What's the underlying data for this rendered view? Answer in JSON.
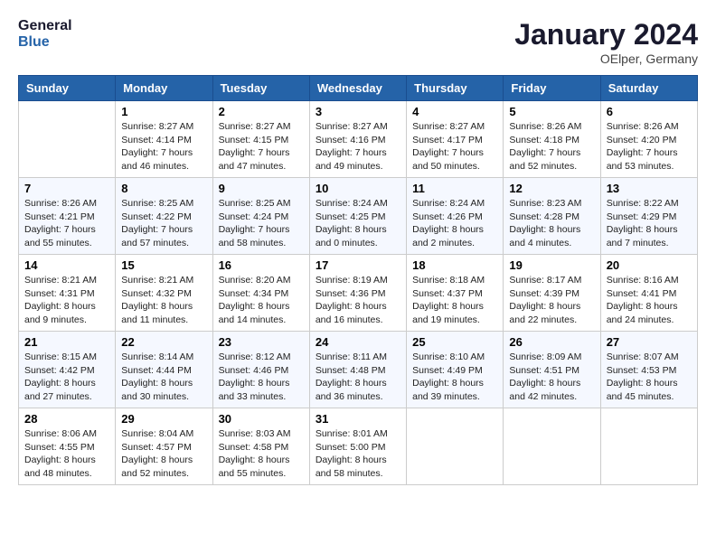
{
  "header": {
    "logo_line1": "General",
    "logo_line2": "Blue",
    "month_title": "January 2024",
    "location": "OElper, Germany"
  },
  "days_of_week": [
    "Sunday",
    "Monday",
    "Tuesday",
    "Wednesday",
    "Thursday",
    "Friday",
    "Saturday"
  ],
  "weeks": [
    [
      {
        "day": "",
        "sunrise": "",
        "sunset": "",
        "daylight": ""
      },
      {
        "day": "1",
        "sunrise": "Sunrise: 8:27 AM",
        "sunset": "Sunset: 4:14 PM",
        "daylight": "Daylight: 7 hours and 46 minutes."
      },
      {
        "day": "2",
        "sunrise": "Sunrise: 8:27 AM",
        "sunset": "Sunset: 4:15 PM",
        "daylight": "Daylight: 7 hours and 47 minutes."
      },
      {
        "day": "3",
        "sunrise": "Sunrise: 8:27 AM",
        "sunset": "Sunset: 4:16 PM",
        "daylight": "Daylight: 7 hours and 49 minutes."
      },
      {
        "day": "4",
        "sunrise": "Sunrise: 8:27 AM",
        "sunset": "Sunset: 4:17 PM",
        "daylight": "Daylight: 7 hours and 50 minutes."
      },
      {
        "day": "5",
        "sunrise": "Sunrise: 8:26 AM",
        "sunset": "Sunset: 4:18 PM",
        "daylight": "Daylight: 7 hours and 52 minutes."
      },
      {
        "day": "6",
        "sunrise": "Sunrise: 8:26 AM",
        "sunset": "Sunset: 4:20 PM",
        "daylight": "Daylight: 7 hours and 53 minutes."
      }
    ],
    [
      {
        "day": "7",
        "sunrise": "Sunrise: 8:26 AM",
        "sunset": "Sunset: 4:21 PM",
        "daylight": "Daylight: 7 hours and 55 minutes."
      },
      {
        "day": "8",
        "sunrise": "Sunrise: 8:25 AM",
        "sunset": "Sunset: 4:22 PM",
        "daylight": "Daylight: 7 hours and 57 minutes."
      },
      {
        "day": "9",
        "sunrise": "Sunrise: 8:25 AM",
        "sunset": "Sunset: 4:24 PM",
        "daylight": "Daylight: 7 hours and 58 minutes."
      },
      {
        "day": "10",
        "sunrise": "Sunrise: 8:24 AM",
        "sunset": "Sunset: 4:25 PM",
        "daylight": "Daylight: 8 hours and 0 minutes."
      },
      {
        "day": "11",
        "sunrise": "Sunrise: 8:24 AM",
        "sunset": "Sunset: 4:26 PM",
        "daylight": "Daylight: 8 hours and 2 minutes."
      },
      {
        "day": "12",
        "sunrise": "Sunrise: 8:23 AM",
        "sunset": "Sunset: 4:28 PM",
        "daylight": "Daylight: 8 hours and 4 minutes."
      },
      {
        "day": "13",
        "sunrise": "Sunrise: 8:22 AM",
        "sunset": "Sunset: 4:29 PM",
        "daylight": "Daylight: 8 hours and 7 minutes."
      }
    ],
    [
      {
        "day": "14",
        "sunrise": "Sunrise: 8:21 AM",
        "sunset": "Sunset: 4:31 PM",
        "daylight": "Daylight: 8 hours and 9 minutes."
      },
      {
        "day": "15",
        "sunrise": "Sunrise: 8:21 AM",
        "sunset": "Sunset: 4:32 PM",
        "daylight": "Daylight: 8 hours and 11 minutes."
      },
      {
        "day": "16",
        "sunrise": "Sunrise: 8:20 AM",
        "sunset": "Sunset: 4:34 PM",
        "daylight": "Daylight: 8 hours and 14 minutes."
      },
      {
        "day": "17",
        "sunrise": "Sunrise: 8:19 AM",
        "sunset": "Sunset: 4:36 PM",
        "daylight": "Daylight: 8 hours and 16 minutes."
      },
      {
        "day": "18",
        "sunrise": "Sunrise: 8:18 AM",
        "sunset": "Sunset: 4:37 PM",
        "daylight": "Daylight: 8 hours and 19 minutes."
      },
      {
        "day": "19",
        "sunrise": "Sunrise: 8:17 AM",
        "sunset": "Sunset: 4:39 PM",
        "daylight": "Daylight: 8 hours and 22 minutes."
      },
      {
        "day": "20",
        "sunrise": "Sunrise: 8:16 AM",
        "sunset": "Sunset: 4:41 PM",
        "daylight": "Daylight: 8 hours and 24 minutes."
      }
    ],
    [
      {
        "day": "21",
        "sunrise": "Sunrise: 8:15 AM",
        "sunset": "Sunset: 4:42 PM",
        "daylight": "Daylight: 8 hours and 27 minutes."
      },
      {
        "day": "22",
        "sunrise": "Sunrise: 8:14 AM",
        "sunset": "Sunset: 4:44 PM",
        "daylight": "Daylight: 8 hours and 30 minutes."
      },
      {
        "day": "23",
        "sunrise": "Sunrise: 8:12 AM",
        "sunset": "Sunset: 4:46 PM",
        "daylight": "Daylight: 8 hours and 33 minutes."
      },
      {
        "day": "24",
        "sunrise": "Sunrise: 8:11 AM",
        "sunset": "Sunset: 4:48 PM",
        "daylight": "Daylight: 8 hours and 36 minutes."
      },
      {
        "day": "25",
        "sunrise": "Sunrise: 8:10 AM",
        "sunset": "Sunset: 4:49 PM",
        "daylight": "Daylight: 8 hours and 39 minutes."
      },
      {
        "day": "26",
        "sunrise": "Sunrise: 8:09 AM",
        "sunset": "Sunset: 4:51 PM",
        "daylight": "Daylight: 8 hours and 42 minutes."
      },
      {
        "day": "27",
        "sunrise": "Sunrise: 8:07 AM",
        "sunset": "Sunset: 4:53 PM",
        "daylight": "Daylight: 8 hours and 45 minutes."
      }
    ],
    [
      {
        "day": "28",
        "sunrise": "Sunrise: 8:06 AM",
        "sunset": "Sunset: 4:55 PM",
        "daylight": "Daylight: 8 hours and 48 minutes."
      },
      {
        "day": "29",
        "sunrise": "Sunrise: 8:04 AM",
        "sunset": "Sunset: 4:57 PM",
        "daylight": "Daylight: 8 hours and 52 minutes."
      },
      {
        "day": "30",
        "sunrise": "Sunrise: 8:03 AM",
        "sunset": "Sunset: 4:58 PM",
        "daylight": "Daylight: 8 hours and 55 minutes."
      },
      {
        "day": "31",
        "sunrise": "Sunrise: 8:01 AM",
        "sunset": "Sunset: 5:00 PM",
        "daylight": "Daylight: 8 hours and 58 minutes."
      },
      {
        "day": "",
        "sunrise": "",
        "sunset": "",
        "daylight": ""
      },
      {
        "day": "",
        "sunrise": "",
        "sunset": "",
        "daylight": ""
      },
      {
        "day": "",
        "sunrise": "",
        "sunset": "",
        "daylight": ""
      }
    ]
  ]
}
